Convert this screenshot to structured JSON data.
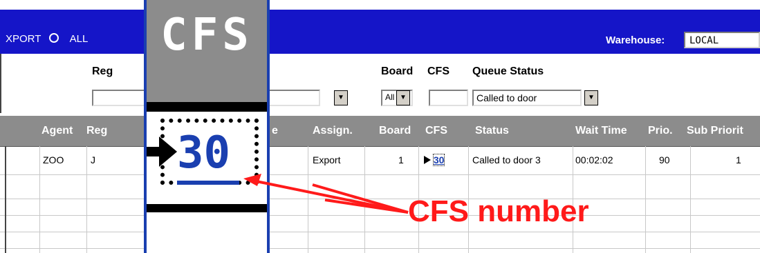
{
  "toolbar": {
    "radio_export_label": "XPORT",
    "radio_all_label": "ALL",
    "warehouse_label": "Warehouse:",
    "warehouse_value": "LOCAL"
  },
  "filters": {
    "reg_label": "Reg",
    "board_label": "Board",
    "cfs_label": "CFS",
    "queue_status_label": "Queue Status",
    "board_value": "All",
    "cfs_value": "",
    "queue_status_value": "Called to door"
  },
  "columns": [
    "Agent",
    "Reg",
    "e",
    "Assign.",
    "Board",
    "CFS",
    "Status",
    "Wait Time",
    "Prio.",
    "Sub Priorit"
  ],
  "row": {
    "agent": "ZOO",
    "reg": "J",
    "assign": "Export",
    "board": "1",
    "cfs": "30",
    "status": "Called to door 3",
    "wait_time": "00:02:02",
    "prio": "90",
    "sub_priority": "1"
  },
  "zoom": {
    "title": "CFS",
    "number": "30"
  },
  "annotation": {
    "text": "CFS number",
    "color": "#ff1a1a"
  },
  "colors": {
    "toolbar_blue": "#1515c8",
    "header_gray": "#8c8c8c",
    "zoom_border": "#1a3fb0",
    "link_blue": "#1a3fb0"
  }
}
